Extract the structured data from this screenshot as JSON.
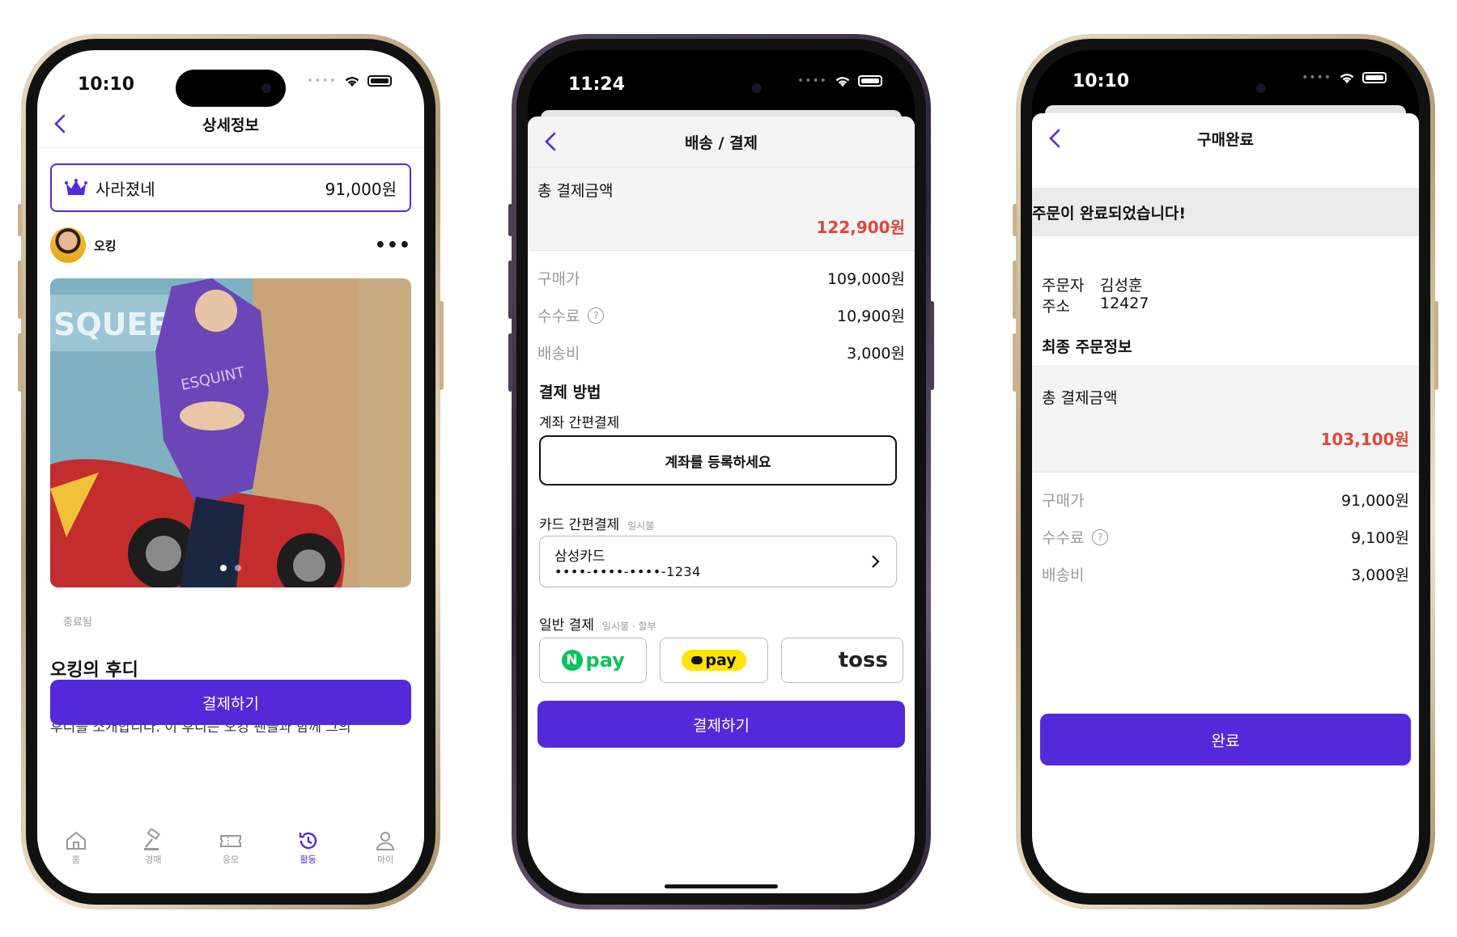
{
  "colors": {
    "accent": "#5429d9",
    "price_red": "#e0463a",
    "gold_frame": "#c7b28d",
    "purple_frame": "#3a2f45"
  },
  "phone1": {
    "status_time": "10:10",
    "nav_title": "상세정보",
    "bid": {
      "name": "사라졌네",
      "price": "91,000원"
    },
    "seller": {
      "name": "오킹"
    },
    "image": {
      "slide_count": 2,
      "active_slide": 1
    },
    "status_label": "종료됨",
    "product_title": "오킹의 후디",
    "cta_label": "결제하기",
    "description_partial": "후디를 소개합니다. 이 후디는 오킹 팬들과 함께 그의",
    "tabs": [
      {
        "label": "홈",
        "icon": "home-icon"
      },
      {
        "label": "경매",
        "icon": "gavel-icon"
      },
      {
        "label": "응모",
        "icon": "ticket-icon"
      },
      {
        "label": "활동",
        "icon": "history-icon",
        "active": true
      },
      {
        "label": "마이",
        "icon": "person-icon"
      }
    ]
  },
  "phone2": {
    "status_time": "11:24",
    "nav_title": "배송 / 결제",
    "total_label": "총 결제금액",
    "total_value": "122,900원",
    "rows": [
      {
        "label": "구매가",
        "value": "109,000원",
        "help": false
      },
      {
        "label": "수수료",
        "value": "10,900원",
        "help": true
      },
      {
        "label": "배송비",
        "value": "3,000원",
        "help": false
      }
    ],
    "payment_method_title": "결제 방법",
    "account_section": "계좌 간편결제",
    "account_button": "계좌를 등록하세요",
    "card_section": "카드 간편결제",
    "card_section_sub": "일시불",
    "card_name": "삼성카드",
    "card_number": "••••-••••-••••-1234",
    "general_section": "일반 결제",
    "general_section_sub": "일시불 · 할부",
    "pay_options": [
      "pay",
      "pay",
      "toss"
    ],
    "cta_label": "결제하기"
  },
  "phone3": {
    "status_time": "10:10",
    "nav_title": "구매완료",
    "banner": "주문이 완료되었습니다!",
    "orderer_label": "주문자",
    "orderer_value": "김성훈",
    "address_label": "주소",
    "address_value": "12427",
    "final_title": "최종 주문정보",
    "total_label": "총 결제금액",
    "total_value": "103,100원",
    "rows": [
      {
        "label": "구매가",
        "value": "91,000원",
        "help": false
      },
      {
        "label": "수수료",
        "value": "9,100원",
        "help": true
      },
      {
        "label": "배송비",
        "value": "3,000원",
        "help": false
      }
    ],
    "cta_label": "완료"
  }
}
